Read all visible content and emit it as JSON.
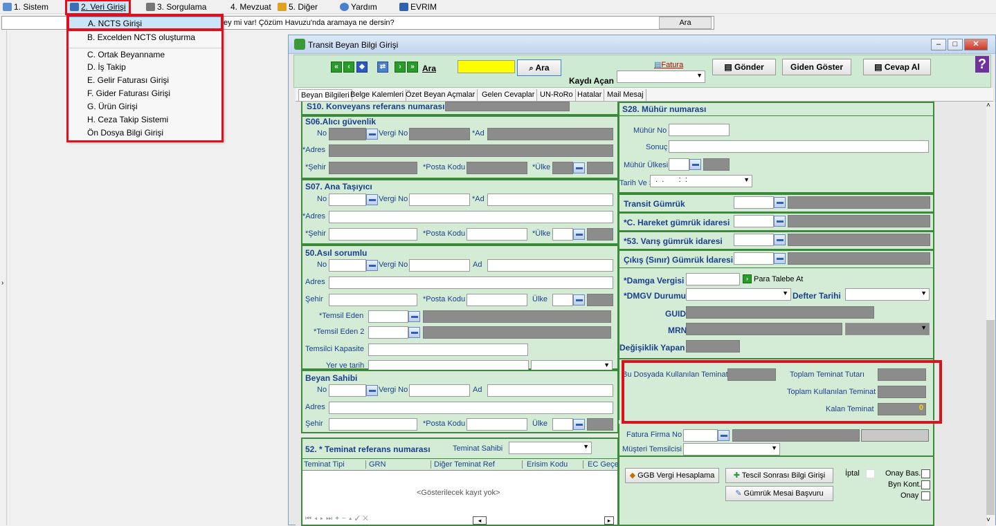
{
  "menubar": {
    "items": [
      {
        "label": "1. Sistem",
        "icon": "system-icon"
      },
      {
        "label": "2. Veri Girişi",
        "icon": "data-entry-icon"
      },
      {
        "label": "3. Sorgulama",
        "icon": "query-icon"
      },
      {
        "label": "4. Mevzuat",
        "icon": ""
      },
      {
        "label": "5. Diğer",
        "icon": "other-icon"
      },
      {
        "label": "Yardım",
        "icon": "help-icon"
      },
      {
        "label": "EVRIM",
        "icon": "evrim-icon"
      }
    ]
  },
  "search": {
    "text": "ey mi var! Çözüm Havuzu'nda aramaya ne dersin?",
    "button": "Ara"
  },
  "dropdown": {
    "items": [
      "A. NCTS Girişi",
      "B. Excelden NCTS oluşturma",
      "C. Ortak Beyanname",
      "D. İş Takip",
      "E. Gelir Faturası Girişi",
      "F. Gider Faturası Girişi",
      "G. Ürün Girişi",
      "H. Ceza Takip Sistemi",
      "Ön Dosya Bilgi Girişi"
    ]
  },
  "window": {
    "title": "Transit Beyan Bilgi Girişi",
    "toolbar": {
      "ara_label": "Ara",
      "ara_button": "Ara",
      "kaydi_acan": "Kaydı Açan",
      "fatura": "Fatura",
      "gonder": "Gönder",
      "giden_goster": "Giden Göster",
      "cevap_al": "Cevap Al"
    },
    "tabs": [
      "Beyan Bilgileri",
      "Belge Kalemleri",
      "Özet Beyan Açmalar",
      "Gelen Cevaplar",
      "UN-RoRo",
      "Hatalar",
      "Mail Mesaj"
    ]
  },
  "form": {
    "s10": "S10. Konveyans referans numarası",
    "s06": {
      "title": "S06.Alıcı güvenlik",
      "no": "No",
      "vergi_no": "Vergi No",
      "ad": "*Ad",
      "adres": "*Adres",
      "sehir": "*Şehir",
      "posta": "*Posta Kodu",
      "ulke": "*Ülke"
    },
    "s07": {
      "title": "S07. Ana Taşıyıcı",
      "no": "No",
      "vergi_no": "Vergi No",
      "ad": "*Ad",
      "adres": "*Adres",
      "sehir": "*Şehir",
      "posta": "*Posta Kodu",
      "ulke": "*Ülke"
    },
    "s50": {
      "title": "50.Asıl sorumlu",
      "no": "No",
      "vergi_no": "Vergi No",
      "ad": "Ad",
      "adres": "Adres",
      "sehir": "Şehir",
      "posta": "*Posta Kodu",
      "ulke": "Ülke",
      "temsil_eden": "*Temsil Eden",
      "temsil_eden2": "*Temsil Eden 2",
      "temsilci_kapasite": "Temsilci Kapasite",
      "yer_tarih": "Yer ve tarih"
    },
    "beyan_sahibi": {
      "title": "Beyan Sahibi",
      "no": "No",
      "vergi_no": "Vergi No",
      "ad": "Ad",
      "adres": "Adres",
      "sehir": "Şehir",
      "posta": "*Posta Kodu",
      "ulke": "Ülke"
    },
    "s52": {
      "title": "52. * Teminat referans numarası",
      "teminat_sahibi": "Teminat Sahibi",
      "columns": [
        "Teminat Tipi",
        "GRN",
        "Diğer Teminat Ref",
        "Erisim Kodu",
        "EC Geçer"
      ],
      "empty": "<Gösterilecek kayıt yok>"
    },
    "s28": {
      "title": "S28. Mühür numarası",
      "muhur_no": "Mühür No",
      "sonuc": "Sonuç",
      "muhur_ulkesi": "Mühür Ülkesi",
      "tarih_saat": "Tarih Ve Saat",
      "tarih_value": " .  .       :  :"
    },
    "transit_gumruk": "Transit Gümrük",
    "hareket": "*C. Hareket gümrük idaresi",
    "varis": "*53. Varış gümrük idaresi",
    "cikis": "Çıkış (Sınır) Gümrük İdaresi",
    "damga": "*Damga Vergisi",
    "para_talebe": "Para Talebe At",
    "dmgv": "*DMGV Durumu",
    "defter_tarihi": "Defter Tarihi",
    "guid": "GUID",
    "mrn": "MRN",
    "degisiklik": "Değişiklik Yapan",
    "teminat": {
      "bu_dosyada": "Bu Dosyada Kullanılan Teminat",
      "toplam_tutar": "Toplam Teminat Tutarı",
      "toplam_kullanilan": "Toplam Kullanılan Teminat",
      "kalan": "Kalan Teminat",
      "kalan_value": "0"
    },
    "fatura_firma": "Fatura Firma No",
    "musteri": "Müşteri Temsilcisi",
    "ggb": "GGB Vergi Hesaplama",
    "tescil": "Tescil Sonrası Bilgi Girişi",
    "gumruk_mesai": "Gümrük Mesai Başvuru",
    "iptal": "İptal",
    "onay_bas": "Onay Bas.",
    "byn_kont": "Byn Kont.",
    "onay": "Onay"
  }
}
